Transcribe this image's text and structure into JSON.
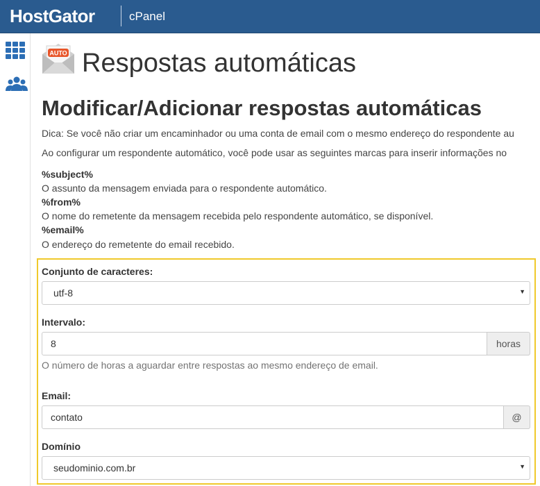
{
  "header": {
    "brand": "HostGator",
    "product": "cPanel"
  },
  "rail": {
    "items": [
      {
        "icon": "apps-grid-icon"
      },
      {
        "icon": "users-icon"
      }
    ]
  },
  "page": {
    "icon_badge": "AUTO",
    "title": "Respostas automáticas",
    "section_title": "Modificar/Adicionar respostas automáticas",
    "tip": "Dica: Se você não criar um encaminhador ou uma conta de email com o mesmo endereço do respondente au",
    "intro": "Ao configurar um respondente automático, você pode usar as seguintes marcas para inserir informações no",
    "tags": [
      {
        "tag": "%subject%",
        "description": "O assunto da mensagem enviada para o respondente automático."
      },
      {
        "tag": "%from%",
        "description": "O nome do remetente da mensagem recebida pelo respondente automático, se disponível."
      },
      {
        "tag": "%email%",
        "description": "O endereço do remetente do email recebido."
      }
    ]
  },
  "form": {
    "charset": {
      "label": "Conjunto de caracteres:",
      "value": "utf-8"
    },
    "interval": {
      "label": "Intervalo:",
      "value": "8",
      "unit": "horas",
      "help": "O número de horas a aguardar entre respostas ao mesmo endereço de email."
    },
    "email": {
      "label": "Email:",
      "value": "contato",
      "addon": "@"
    },
    "domain": {
      "label": "Domínio",
      "value": "seudominio.com.br"
    }
  },
  "colors": {
    "topbar": "#2a5b8f",
    "accent_icon": "#2c6eb5",
    "highlight_frame": "#f0c92b",
    "auto_badge": "#e8562a"
  }
}
